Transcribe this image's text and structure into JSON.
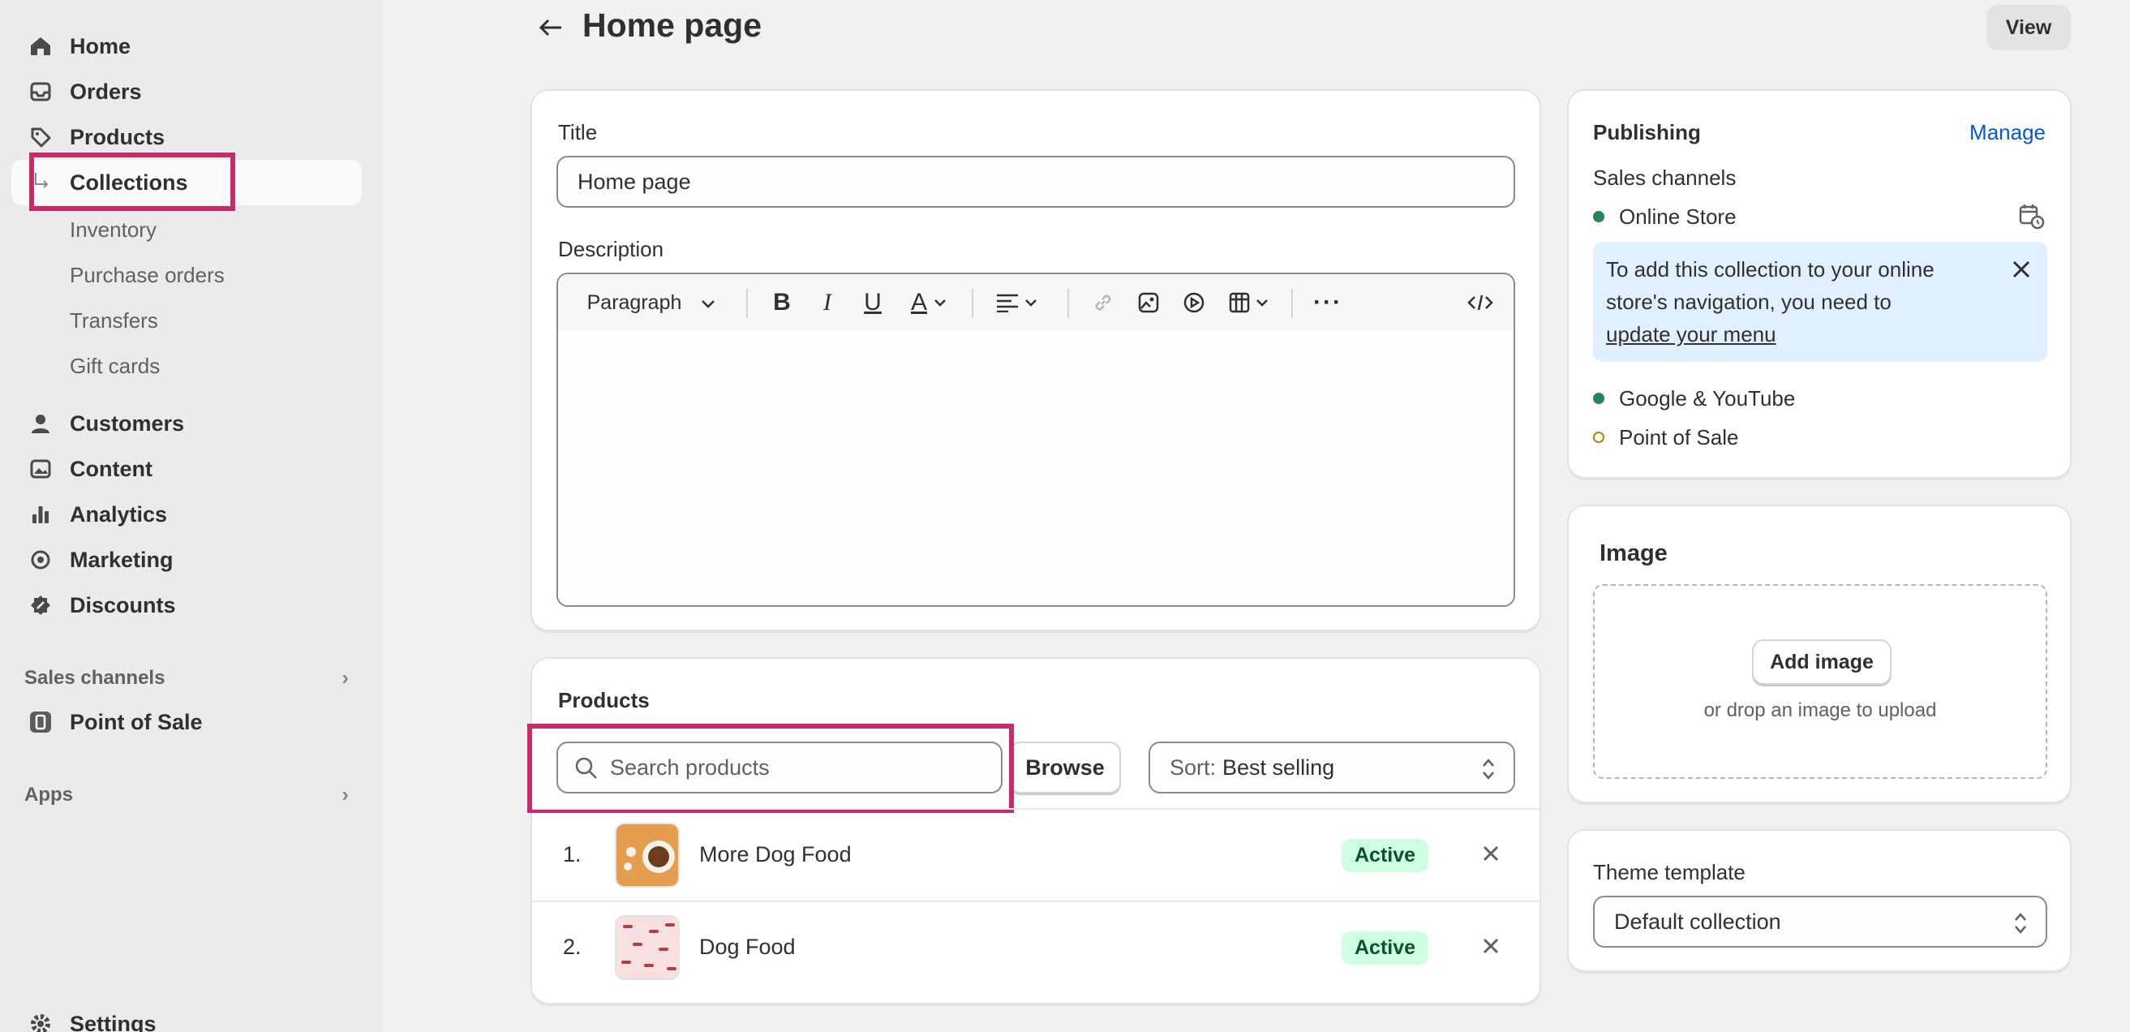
{
  "sidebar": {
    "main_items": [
      {
        "label": "Home",
        "icon": "home-icon"
      },
      {
        "label": "Orders",
        "icon": "inbox-icon"
      },
      {
        "label": "Products",
        "icon": "tag-icon"
      },
      {
        "label": "Collections"
      }
    ],
    "sub_items": [
      "Inventory",
      "Purchase orders",
      "Transfers",
      "Gift cards"
    ],
    "secondary_items": [
      {
        "label": "Customers",
        "icon": "person-icon"
      },
      {
        "label": "Content",
        "icon": "image-icon"
      },
      {
        "label": "Analytics",
        "icon": "bar-chart-icon"
      },
      {
        "label": "Marketing",
        "icon": "target-icon"
      },
      {
        "label": "Discounts",
        "icon": "discount-icon"
      }
    ],
    "sales_channels_heading": "Sales channels",
    "pos_label": "Point of Sale",
    "apps_heading": "Apps",
    "settings_label": "Settings"
  },
  "header": {
    "title": "Home page",
    "view_button": "View"
  },
  "title_card": {
    "title_label": "Title",
    "title_value": "Home page",
    "description_label": "Description",
    "paragraph_label": "Paragraph"
  },
  "products_card": {
    "heading": "Products",
    "search_placeholder": "Search products",
    "browse_label": "Browse",
    "sort_prefix": "Sort:",
    "sort_value": "Best selling",
    "rows": [
      {
        "index": "1.",
        "name": "More Dog Food",
        "status": "Active"
      },
      {
        "index": "2.",
        "name": "Dog Food",
        "status": "Active"
      }
    ]
  },
  "publishing": {
    "heading": "Publishing",
    "manage_link": "Manage",
    "sales_channels_label": "Sales channels",
    "online_store": "Online Store",
    "notice_text": "To add this collection to your online store's navigation, you need to",
    "notice_link": "update your menu",
    "google_youtube": "Google & YouTube",
    "point_of_sale": "Point of Sale"
  },
  "image_card": {
    "heading": "Image",
    "add_image": "Add image",
    "drop_hint": "or drop an image to upload"
  },
  "theme_card": {
    "label": "Theme template",
    "value": "Default collection"
  },
  "colors": {
    "highlight": "#c72c6a",
    "link": "#005bd3",
    "active_badge_bg": "#cdfee1",
    "channel_dot_active": "#29845a",
    "channel_dot_inactive": "#b28400"
  }
}
